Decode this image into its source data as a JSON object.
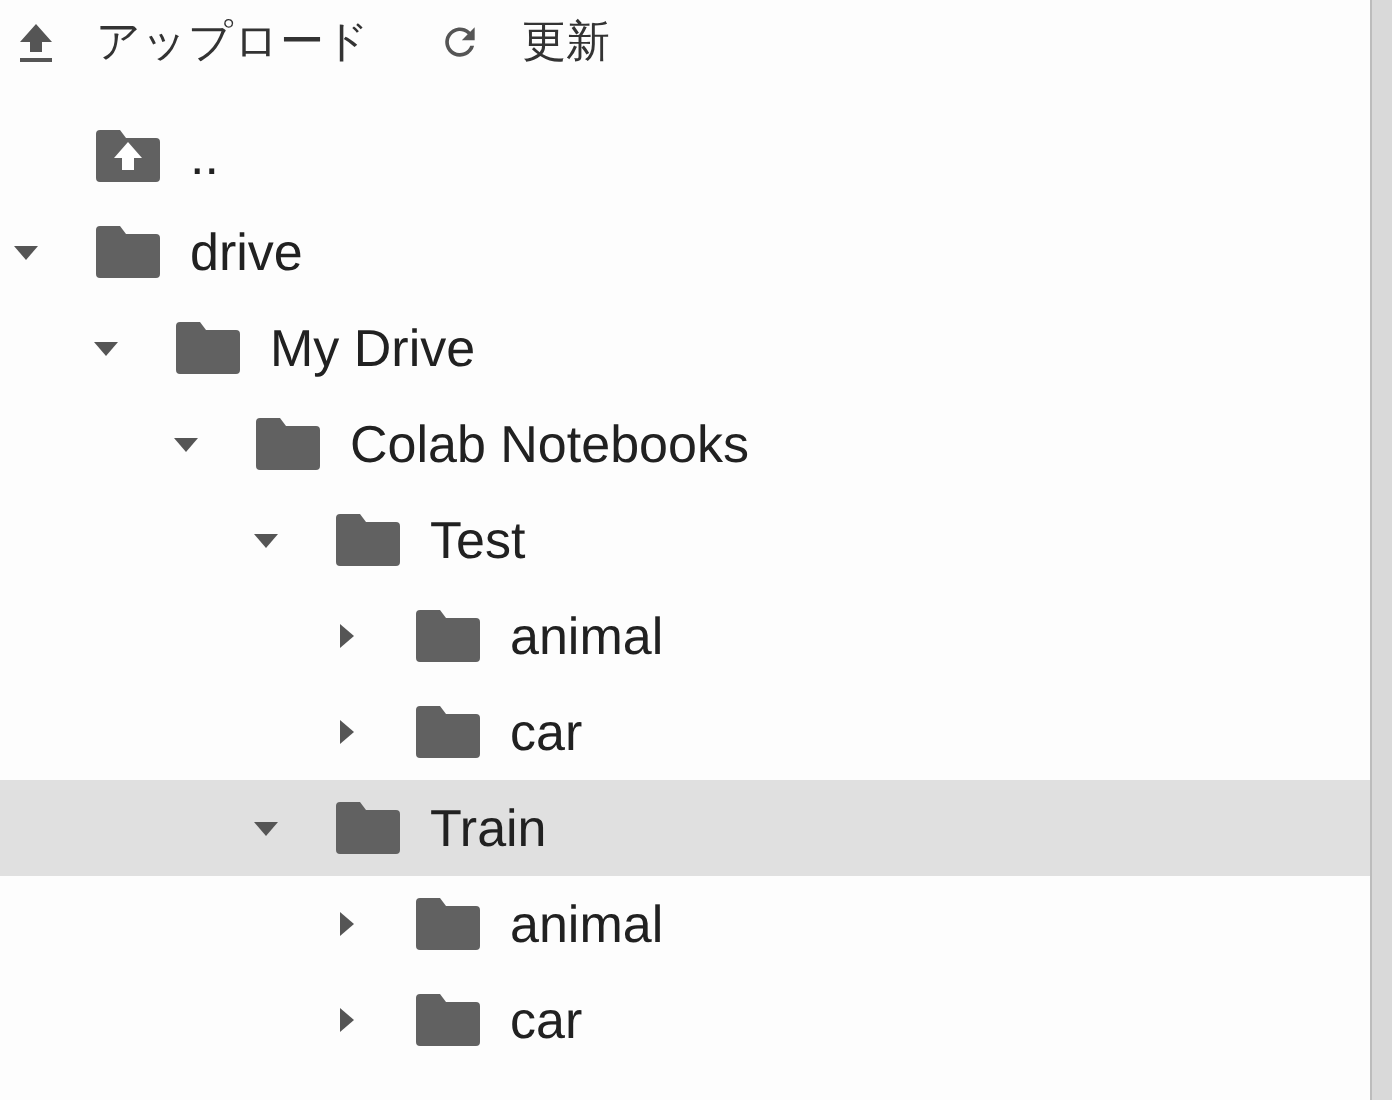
{
  "toolbar": [
    {
      "kind": "upload",
      "label": "アップロード"
    },
    {
      "kind": "refresh",
      "label": "更新"
    }
  ],
  "parent_link": {
    "label": ".."
  },
  "tree": [
    {
      "name": "drive",
      "expanded": true,
      "selected": false,
      "children": [
        {
          "name": "My Drive",
          "expanded": true,
          "selected": false,
          "children": [
            {
              "name": "Colab Notebooks",
              "expanded": true,
              "selected": false,
              "children": [
                {
                  "name": "Test",
                  "expanded": true,
                  "selected": false,
                  "children": [
                    {
                      "name": "animal",
                      "expanded": false,
                      "selected": false
                    },
                    {
                      "name": "car",
                      "expanded": false,
                      "selected": false
                    }
                  ]
                },
                {
                  "name": "Train",
                  "expanded": true,
                  "selected": true,
                  "children": [
                    {
                      "name": "animal",
                      "expanded": false,
                      "selected": false
                    },
                    {
                      "name": "car",
                      "expanded": false,
                      "selected": false
                    }
                  ]
                }
              ]
            }
          ]
        }
      ]
    }
  ]
}
